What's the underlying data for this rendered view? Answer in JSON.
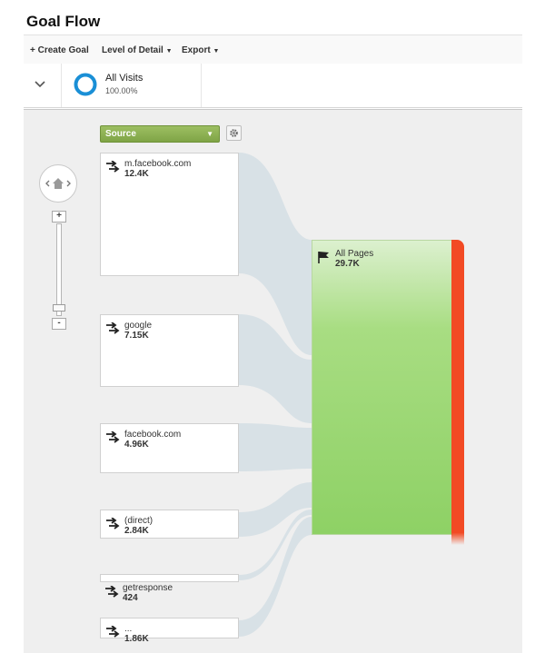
{
  "page": {
    "title": "Goal Flow"
  },
  "toolbar": {
    "create_goal": "+ Create Goal",
    "level_of_detail": "Level of Detail",
    "export": "Export"
  },
  "segment": {
    "name": "All Visits",
    "percent": "100.00%",
    "share": 1.0
  },
  "dimension_selector": {
    "selected": "Source"
  },
  "zoom": {
    "plus": "+",
    "minus": "-"
  },
  "sources": [
    {
      "name": "m.facebook.com",
      "value": "12.4K"
    },
    {
      "name": "google",
      "value": "7.15K"
    },
    {
      "name": "facebook.com",
      "value": "4.96K"
    },
    {
      "name": "(direct)",
      "value": "2.84K"
    },
    {
      "name": "getresponse",
      "value": "424"
    },
    {
      "name": "...",
      "value": "1.86K"
    }
  ],
  "goal_node": {
    "name": "All Pages",
    "value": "29.7K"
  },
  "colors": {
    "source_selector": "#8bb04f",
    "goal_fill": "#8ed165",
    "dropoff": "#f24a24",
    "flow": "#d8e1e6",
    "segment_ring": "#1a8fd6"
  },
  "icons": {
    "collapse": "chevron-down-icon",
    "segment": "ring-icon",
    "settings": "gear-icon",
    "pan": "home-icon",
    "source": "arrows-icon",
    "goal": "flag-icon"
  }
}
